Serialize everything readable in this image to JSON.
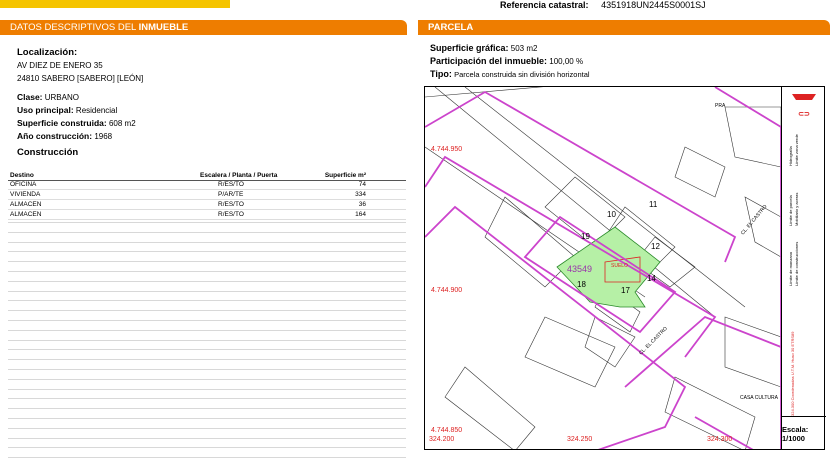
{
  "header": {
    "ref_label": "Referencia catastral:",
    "ref_value": "4351918UN2445S0001SJ"
  },
  "left_section": {
    "title_normal": "DATOS DESCRIPTIVOS DEL ",
    "title_bold": "INMUEBLE",
    "localizacion_label": "Localización:",
    "address_line1": "AV DIEZ DE ENERO 35",
    "address_line2": "24810 SABERO [SABERO] [LEÓN]",
    "clase_label": "Clase:",
    "clase_value": "URBANO",
    "uso_label": "Uso principal:",
    "uso_value": "Residencial",
    "superficie_label": "Superficie construida:",
    "superficie_value": "608 m2",
    "anio_label": "Año construcción:",
    "anio_value": "1968",
    "construccion_title": "Construcción",
    "table_headers": [
      "Destino",
      "Escalera / Planta / Puerta",
      "Superficie m²"
    ],
    "table_rows": [
      [
        "OFICINA",
        "R/ES/TO",
        "74"
      ],
      [
        "VIVIENDA",
        "P/AR/TE",
        "334"
      ],
      [
        "ALMACEN",
        "R/ES/TO",
        "36"
      ],
      [
        "ALMACEN",
        "R/ES/TO",
        "164"
      ]
    ]
  },
  "right_section": {
    "title": "PARCELA",
    "sup_label": "Superficie gráfica:",
    "sup_value": "503 m2",
    "part_label": "Participación del inmueble:",
    "part_value": "100,00 %",
    "tipo_label": "Tipo:",
    "tipo_value": "Parcela construida sin división horizontal"
  },
  "map": {
    "coord_labels": [
      "4.744.950",
      "4.744.900",
      "4.744.850",
      "324.200",
      "324.250",
      "324.300"
    ],
    "parcel_label": "43549",
    "parcel_numbers": [
      "10",
      "11",
      "12",
      "14",
      "17",
      "18",
      "19"
    ],
    "street_labels": [
      "CL. EL CASTRO",
      "CL. EL CASTRO"
    ],
    "place_labels": [
      "PRA",
      "CASA CULTURA",
      "SUELO"
    ],
    "legend_items": [
      "Hidrografía",
      "Límite zona verde",
      "Límite de parcela",
      "Mobiliario y aceras",
      "Límite de manzana",
      "Límite de construcciones"
    ],
    "projection": "324.300 Coordenadas U.T.M. Huso 30 ETRS89",
    "scale_label": "Escala:",
    "scale_value": "1/1000"
  },
  "colors": {
    "accent": "#ee7d00",
    "parcel_fill": "#b6f0a6",
    "block_line": "#cc44cc",
    "coord_red": "#dd2222"
  }
}
